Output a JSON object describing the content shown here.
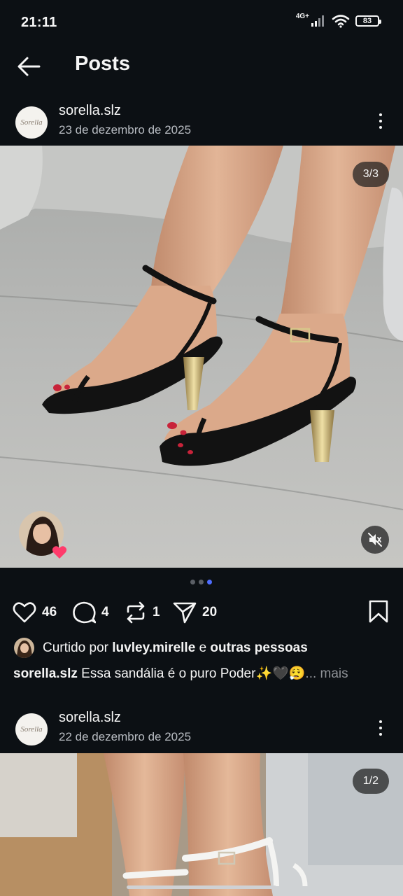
{
  "status_bar": {
    "time": "21:11",
    "network": "4G+",
    "battery": "83"
  },
  "header": {
    "title": "Posts"
  },
  "posts": [
    {
      "username": "sorella.slz",
      "date": "23 de dezembro de 2025",
      "avatar_text": "Sorella",
      "counter": "3/3",
      "likes": "46",
      "comments": "4",
      "reposts": "1",
      "shares": "20",
      "liked_prefix": "Curtido por",
      "liked_user": "luvley.mirelle",
      "liked_conj": "e",
      "liked_others": "outras pessoas",
      "caption_user": "sorella.slz",
      "caption_text": "Essa sandália é o puro Poder✨🖤😮‍💨",
      "caption_more": "... mais"
    },
    {
      "username": "sorella.slz",
      "date": "22 de dezembro de 2025",
      "avatar_text": "Sorella",
      "counter": "1/2"
    }
  ],
  "colors": {
    "background": "#0c1014",
    "text": "#f5f5f5",
    "secondary": "#b8bcc2",
    "active_dot": "#4f6dff",
    "heart_badge": "#ff3b6b"
  },
  "icons": [
    "back-arrow-icon",
    "more-vertical-icon",
    "heart-icon",
    "comment-icon",
    "repost-icon",
    "send-icon",
    "bookmark-icon",
    "mute-icon",
    "wifi-icon",
    "signal-icon",
    "battery-icon"
  ]
}
